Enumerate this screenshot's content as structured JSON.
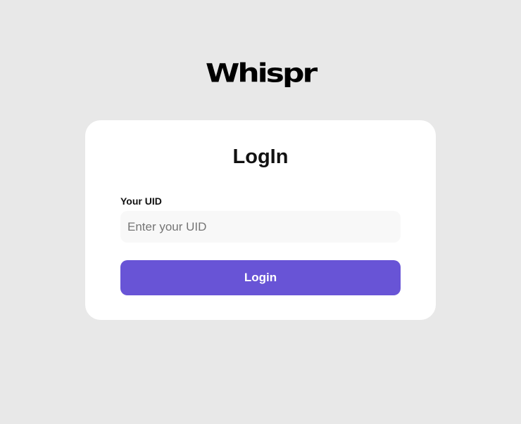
{
  "app": {
    "logo_text": "Whispr"
  },
  "login_card": {
    "title": "LogIn",
    "uid_label": "Your UID",
    "uid_placeholder": "Enter your UID",
    "uid_value": "",
    "login_button_label": "Login"
  },
  "colors": {
    "page_background": "#e8e8e8",
    "card_background": "#ffffff",
    "input_background": "#f8f8f8",
    "accent": "#6854d6"
  }
}
